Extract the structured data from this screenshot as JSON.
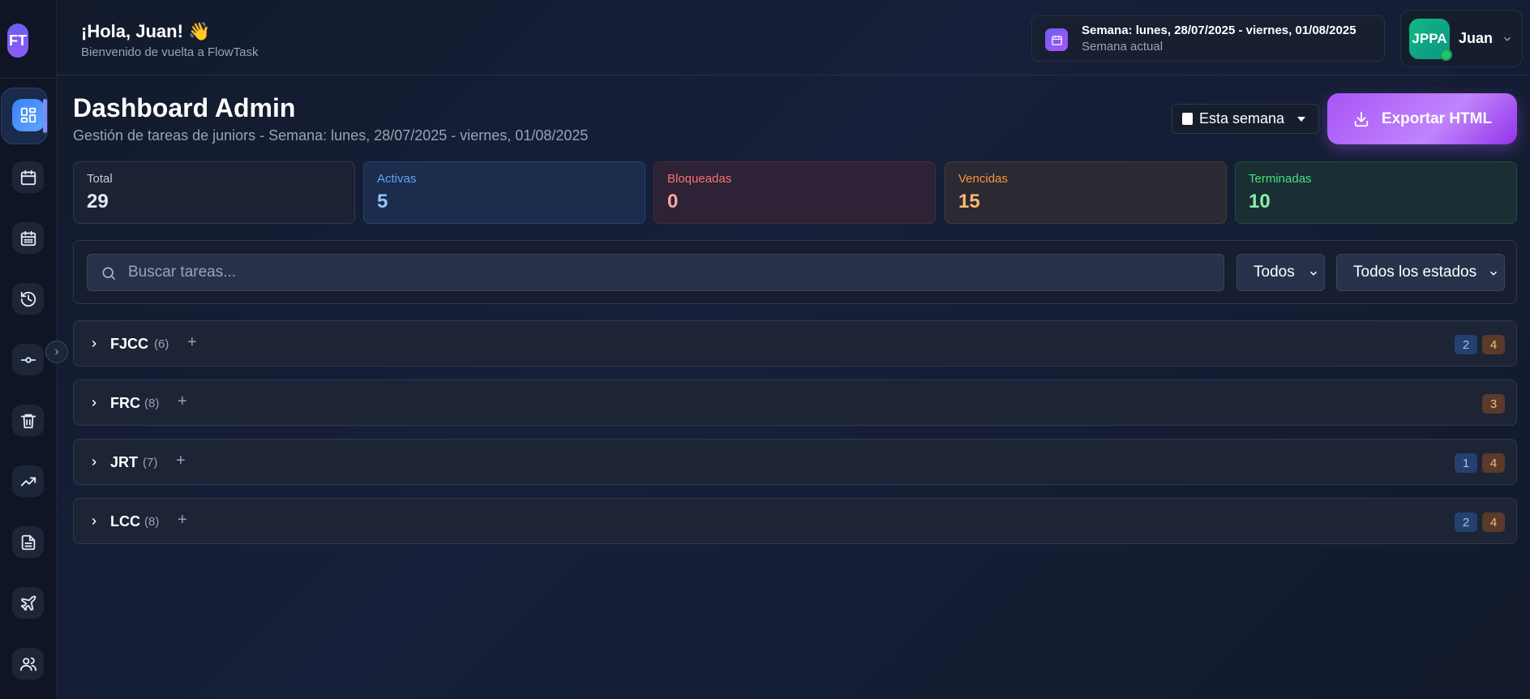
{
  "app": {
    "logo": "FT"
  },
  "header": {
    "greeting": "¡Hola, Juan! 👋",
    "subtitle": "Bienvenido de vuelta a FlowTask",
    "week_title": "Semana: lunes, 28/07/2025 - viernes, 01/08/2025",
    "week_sub": "Semana actual",
    "user_initials": "JPPA",
    "user_name": "Juan"
  },
  "sidebar": {
    "items": [
      {
        "icon": "dashboard-icon",
        "active": true
      },
      {
        "icon": "calendar-icon"
      },
      {
        "icon": "calendar-grid-icon"
      },
      {
        "icon": "history-icon"
      },
      {
        "icon": "commit-icon"
      },
      {
        "icon": "trash-icon"
      },
      {
        "icon": "trending-up-icon"
      },
      {
        "icon": "document-icon"
      },
      {
        "icon": "plane-icon"
      },
      {
        "icon": "users-icon"
      }
    ]
  },
  "page": {
    "title": "Dashboard Admin",
    "subtitle": "Gestión de tareas de juniors - Semana: lunes, 28/07/2025 - viernes, 01/08/2025",
    "week_select": "Esta semana",
    "export_label": "Exportar HTML"
  },
  "stats": [
    {
      "label": "Total",
      "value": "29",
      "color": "#e5e9f2",
      "label_color": "#c3c9d6",
      "bg": "#1a2233",
      "border": "#2e3850"
    },
    {
      "label": "Activas",
      "value": "5",
      "color": "#93c5fd",
      "label_color": "#60a5fa",
      "bg": "#1c2c4c",
      "border": "#2a4170"
    },
    {
      "label": "Bloqueadas",
      "value": "0",
      "color": "#fca5a5",
      "label_color": "#f87171",
      "bg": "#2e2236",
      "border": "#4a2c3a"
    },
    {
      "label": "Vencidas",
      "value": "15",
      "color": "#fdba74",
      "label_color": "#fb923c",
      "bg": "#2b2a32",
      "border": "#4a3a32"
    },
    {
      "label": "Terminadas",
      "value": "10",
      "color": "#86efac",
      "label_color": "#4ade80",
      "bg": "#1a2f34",
      "border": "#244a40"
    }
  ],
  "filters": {
    "search_placeholder": "Buscar tareas...",
    "select_all": "Todos",
    "select_status": "Todos los estados"
  },
  "groups": [
    {
      "name": "FJCC",
      "count": "(6)",
      "badges": [
        {
          "value": "2",
          "kind": "blue"
        },
        {
          "value": "4",
          "kind": "orange"
        }
      ]
    },
    {
      "name": "FRC",
      "count": "(8)",
      "badges": [
        {
          "value": "3",
          "kind": "orange"
        }
      ]
    },
    {
      "name": "JRT",
      "count": "(7)",
      "badges": [
        {
          "value": "1",
          "kind": "blue"
        },
        {
          "value": "4",
          "kind": "orange"
        }
      ]
    },
    {
      "name": "LCC",
      "count": "(8)",
      "badges": [
        {
          "value": "2",
          "kind": "blue"
        },
        {
          "value": "4",
          "kind": "orange"
        }
      ]
    }
  ]
}
